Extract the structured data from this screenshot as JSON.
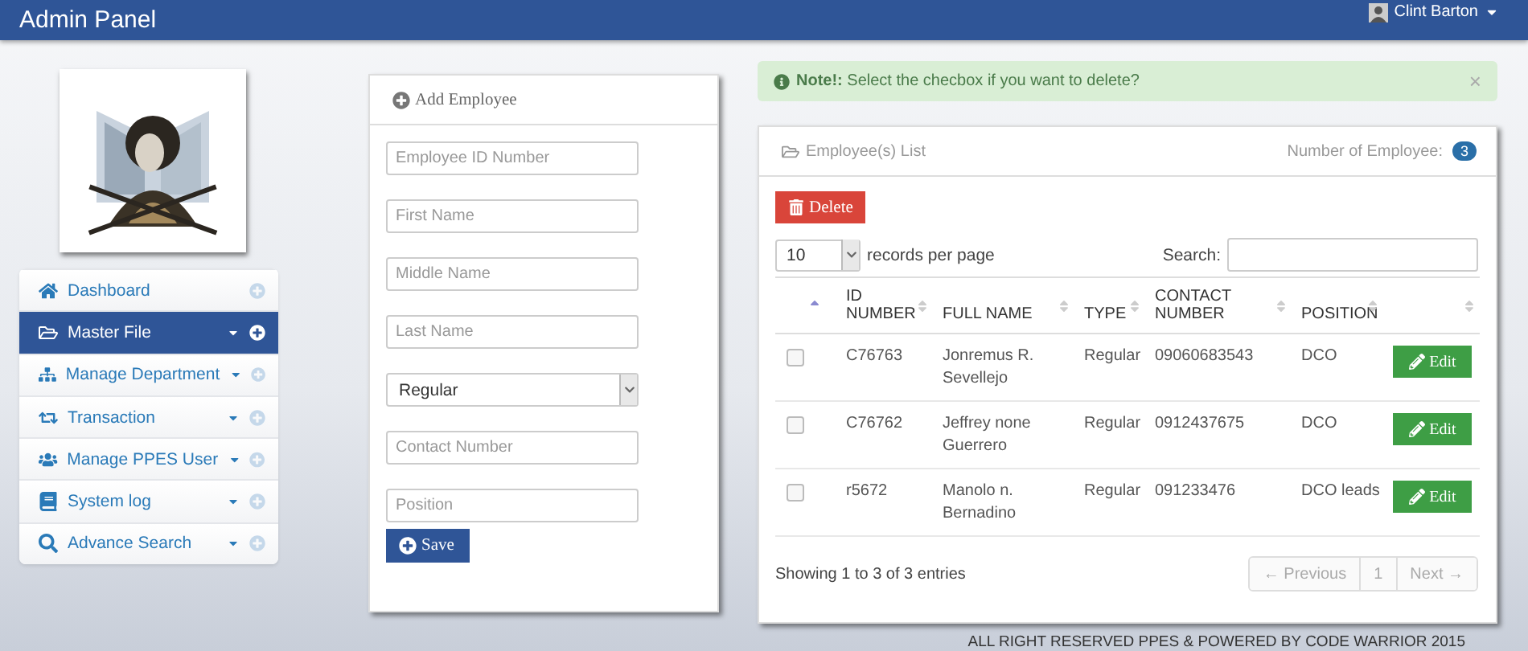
{
  "header": {
    "title": "Admin Panel",
    "user": "Clint Barton"
  },
  "sidebar": {
    "items": [
      {
        "label": "Dashboard",
        "selected": false,
        "dropdown": false
      },
      {
        "label": "Master File",
        "selected": true,
        "dropdown": true
      },
      {
        "label": "Manage Department",
        "selected": false,
        "dropdown": true
      },
      {
        "label": "Transaction",
        "selected": false,
        "dropdown": true
      },
      {
        "label": "Manage PPES User",
        "selected": false,
        "dropdown": true
      },
      {
        "label": "System log",
        "selected": false,
        "dropdown": true
      },
      {
        "label": "Advance Search",
        "selected": false,
        "dropdown": true
      }
    ]
  },
  "form": {
    "title": "Add Employee",
    "fields": [
      {
        "kind": "text",
        "placeholder": "Employee ID Number"
      },
      {
        "kind": "text",
        "placeholder": "First Name"
      },
      {
        "kind": "text",
        "placeholder": "Middle Name"
      },
      {
        "kind": "text",
        "placeholder": "Last Name"
      },
      {
        "kind": "select",
        "value": "Regular"
      },
      {
        "kind": "text",
        "placeholder": "Contact Number"
      },
      {
        "kind": "text",
        "placeholder": "Position"
      }
    ],
    "save": "Save"
  },
  "alert": {
    "label": "Note!:",
    "text": "Select the checbox if you want to delete?",
    "close": "×"
  },
  "employees": {
    "title": "Employee(s) List",
    "count_label": "Number of Employee:",
    "count": "3",
    "delete": "Delete",
    "page_size": "10",
    "page_size_label": "records per page",
    "search_label": "Search:",
    "columns": [
      "ID NUMBER",
      "FULL NAME",
      "TYPE",
      "CONTACT NUMBER",
      "POSITION"
    ],
    "rows": [
      {
        "checked": false,
        "cells": [
          "C76763",
          "Jonremus R. Sevellejo",
          "Regular",
          "09060683543",
          "DCO"
        ],
        "action": "Edit"
      },
      {
        "checked": false,
        "cells": [
          "C76762",
          "Jeffrey none Guerrero",
          "Regular",
          "0912437675",
          "DCO"
        ],
        "action": "Edit"
      },
      {
        "checked": false,
        "cells": [
          "r5672",
          "Manolo n. Bernadino",
          "Regular",
          "091233476",
          "DCO leads"
        ],
        "action": "Edit"
      }
    ],
    "info": "Showing 1 to 3 of 3 entries",
    "pages": [
      {
        "label": "← Previous",
        "disabled": true
      },
      {
        "label": "1",
        "disabled": true
      },
      {
        "label": "Next →",
        "disabled": true
      }
    ]
  },
  "footer": "ALL RIGHT RESERVED PPES & POWERED BY CODE WARRIOR 2015"
}
